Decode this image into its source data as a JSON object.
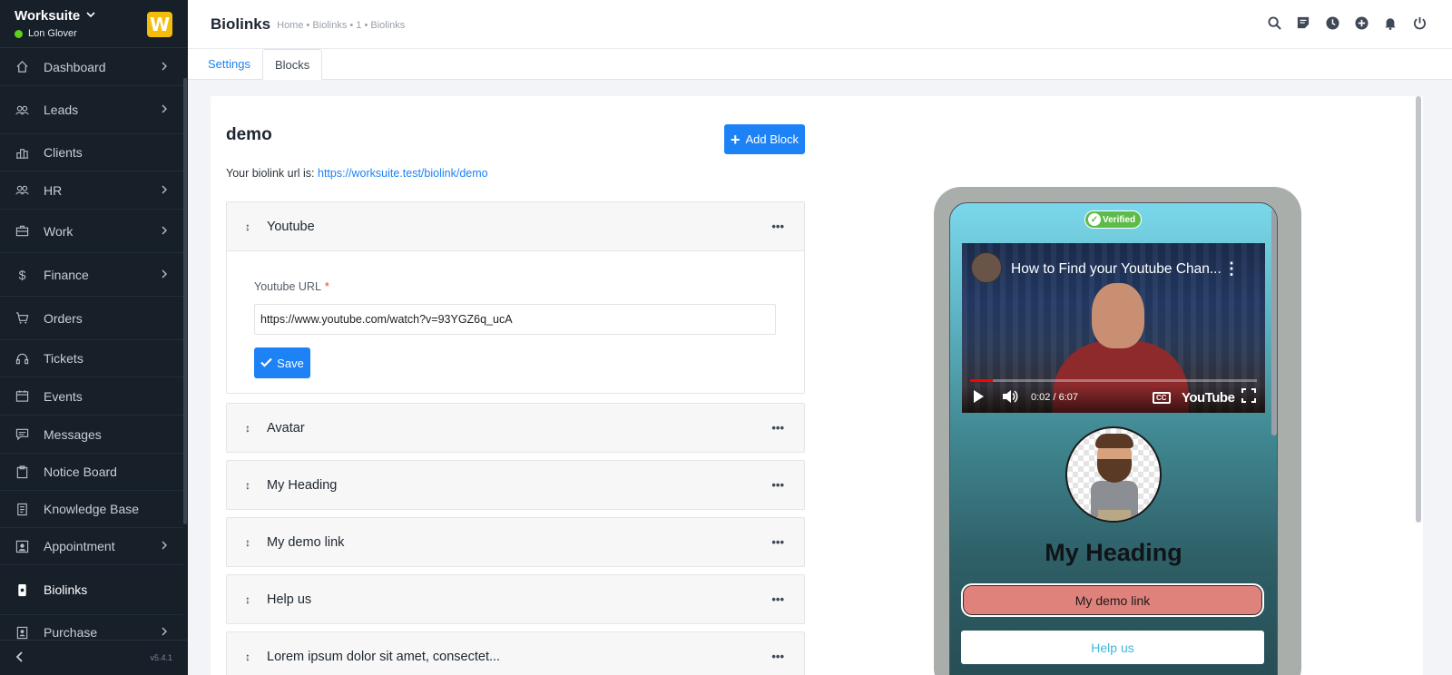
{
  "app": {
    "name": "Worksuite",
    "user": "Lon Glover",
    "logo_letter": "W",
    "version": "v5.4.1"
  },
  "sidebar": {
    "items": [
      {
        "label": "Dashboard",
        "icon": "home-icon",
        "chevron": true
      },
      {
        "label": "Leads",
        "icon": "users-icon",
        "chevron": true
      },
      {
        "label": "Clients",
        "icon": "building-icon",
        "chevron": false
      },
      {
        "label": "HR",
        "icon": "people-icon",
        "chevron": true
      },
      {
        "label": "Work",
        "icon": "briefcase-icon",
        "chevron": true
      },
      {
        "label": "Finance",
        "icon": "dollar-icon",
        "chevron": true
      },
      {
        "label": "Orders",
        "icon": "cart-icon",
        "chevron": false
      },
      {
        "label": "Tickets",
        "icon": "headset-icon",
        "chevron": false
      },
      {
        "label": "Events",
        "icon": "calendar-icon",
        "chevron": false
      },
      {
        "label": "Messages",
        "icon": "chat-icon",
        "chevron": false
      },
      {
        "label": "Notice Board",
        "icon": "clipboard-icon",
        "chevron": false
      },
      {
        "label": "Knowledge Base",
        "icon": "book-icon",
        "chevron": false
      },
      {
        "label": "Appointment",
        "icon": "calendar-person-icon",
        "chevron": true
      },
      {
        "label": "Biolinks",
        "icon": "phone-icon",
        "chevron": false,
        "active": true
      },
      {
        "label": "Purchase",
        "icon": "receipt-icon",
        "chevron": true
      }
    ]
  },
  "header": {
    "title": "Biolinks",
    "breadcrumb": "Home • Biolinks • 1 • Biolinks",
    "icons": [
      "search-icon",
      "sticky-note-icon",
      "clock-icon",
      "plus-circle-icon",
      "bell-icon",
      "power-icon"
    ]
  },
  "tabs": [
    {
      "label": "Settings",
      "active": false
    },
    {
      "label": "Blocks",
      "active": true
    }
  ],
  "main": {
    "title": "demo",
    "add_block_label": "Add Block",
    "url_prefix": "Your biolink url is:",
    "url": "https://worksuite.test/biolink/demo",
    "youtube_block": {
      "name": "Youtube",
      "field_label": "Youtube URL",
      "required_mark": "*",
      "field_value": "https://www.youtube.com/watch?v=93YGZ6q_ucA",
      "save_label": "Save"
    },
    "blocks": [
      {
        "name": "Avatar"
      },
      {
        "name": "My Heading"
      },
      {
        "name": "My demo link"
      },
      {
        "name": "Help us"
      },
      {
        "name": "Lorem ipsum dolor sit amet, consectet..."
      }
    ],
    "more_glyph": "•••",
    "drag_glyph": "↕"
  },
  "preview": {
    "verified_label": "Verified",
    "video": {
      "title": "How to Find your Youtube Chan...",
      "time": "0:02 / 6:07",
      "brand": "YouTube",
      "cc": "CC",
      "progress": 0.08
    },
    "heading": "My Heading",
    "link_demo": "My demo link",
    "link_help": "Help us"
  },
  "colors": {
    "accent": "#1d82f5",
    "sidebar_bg": "#171f29",
    "logo": "#f5bd0b",
    "online": "#5ed01b",
    "verified": "#5dbb49",
    "demo_link_bg": "#e0827c"
  }
}
